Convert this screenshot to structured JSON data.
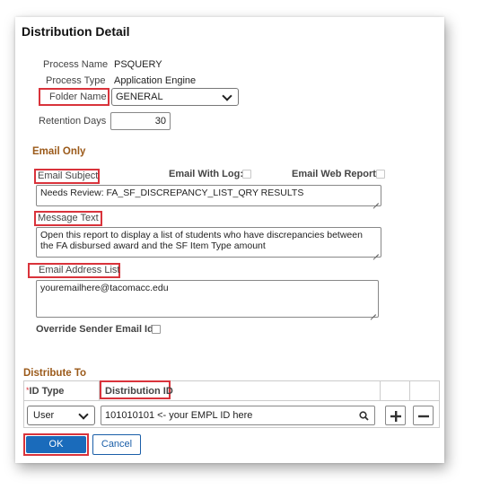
{
  "page_title": "Distribution Detail",
  "process_name": {
    "label": "Process Name",
    "value": "PSQUERY"
  },
  "process_type": {
    "label": "Process Type",
    "value": "Application Engine"
  },
  "folder_name": {
    "label": "Folder Name",
    "value": "GENERAL"
  },
  "retention_days": {
    "label": "Retention Days",
    "value": "30"
  },
  "email_only": {
    "heading": "Email Only",
    "subject_label": "Email Subject",
    "with_log_label": "Email With Log:",
    "web_report_label": "Email Web Report:",
    "subject_value": "Needs Review:  FA_SF_DISCREPANCY_LIST_QRY RESULTS",
    "message_label": "Message Text",
    "message_value": "Open this report to display a list of students who have discrepancies between the FA disbursed award and the SF Item Type amount",
    "address_label": "Email Address List",
    "address_value": "youremailhere@tacomacc.edu",
    "override_label": "Override Sender Email Id:"
  },
  "distribute_to": {
    "heading": "Distribute To",
    "col_id_type": "ID Type",
    "col_required_mark": "*",
    "col_distribution_id": "Distribution ID",
    "row": {
      "id_type": "User",
      "distribution_id": "101010101 <- your EMPL ID here"
    }
  },
  "buttons": {
    "ok": "OK",
    "cancel": "Cancel"
  }
}
